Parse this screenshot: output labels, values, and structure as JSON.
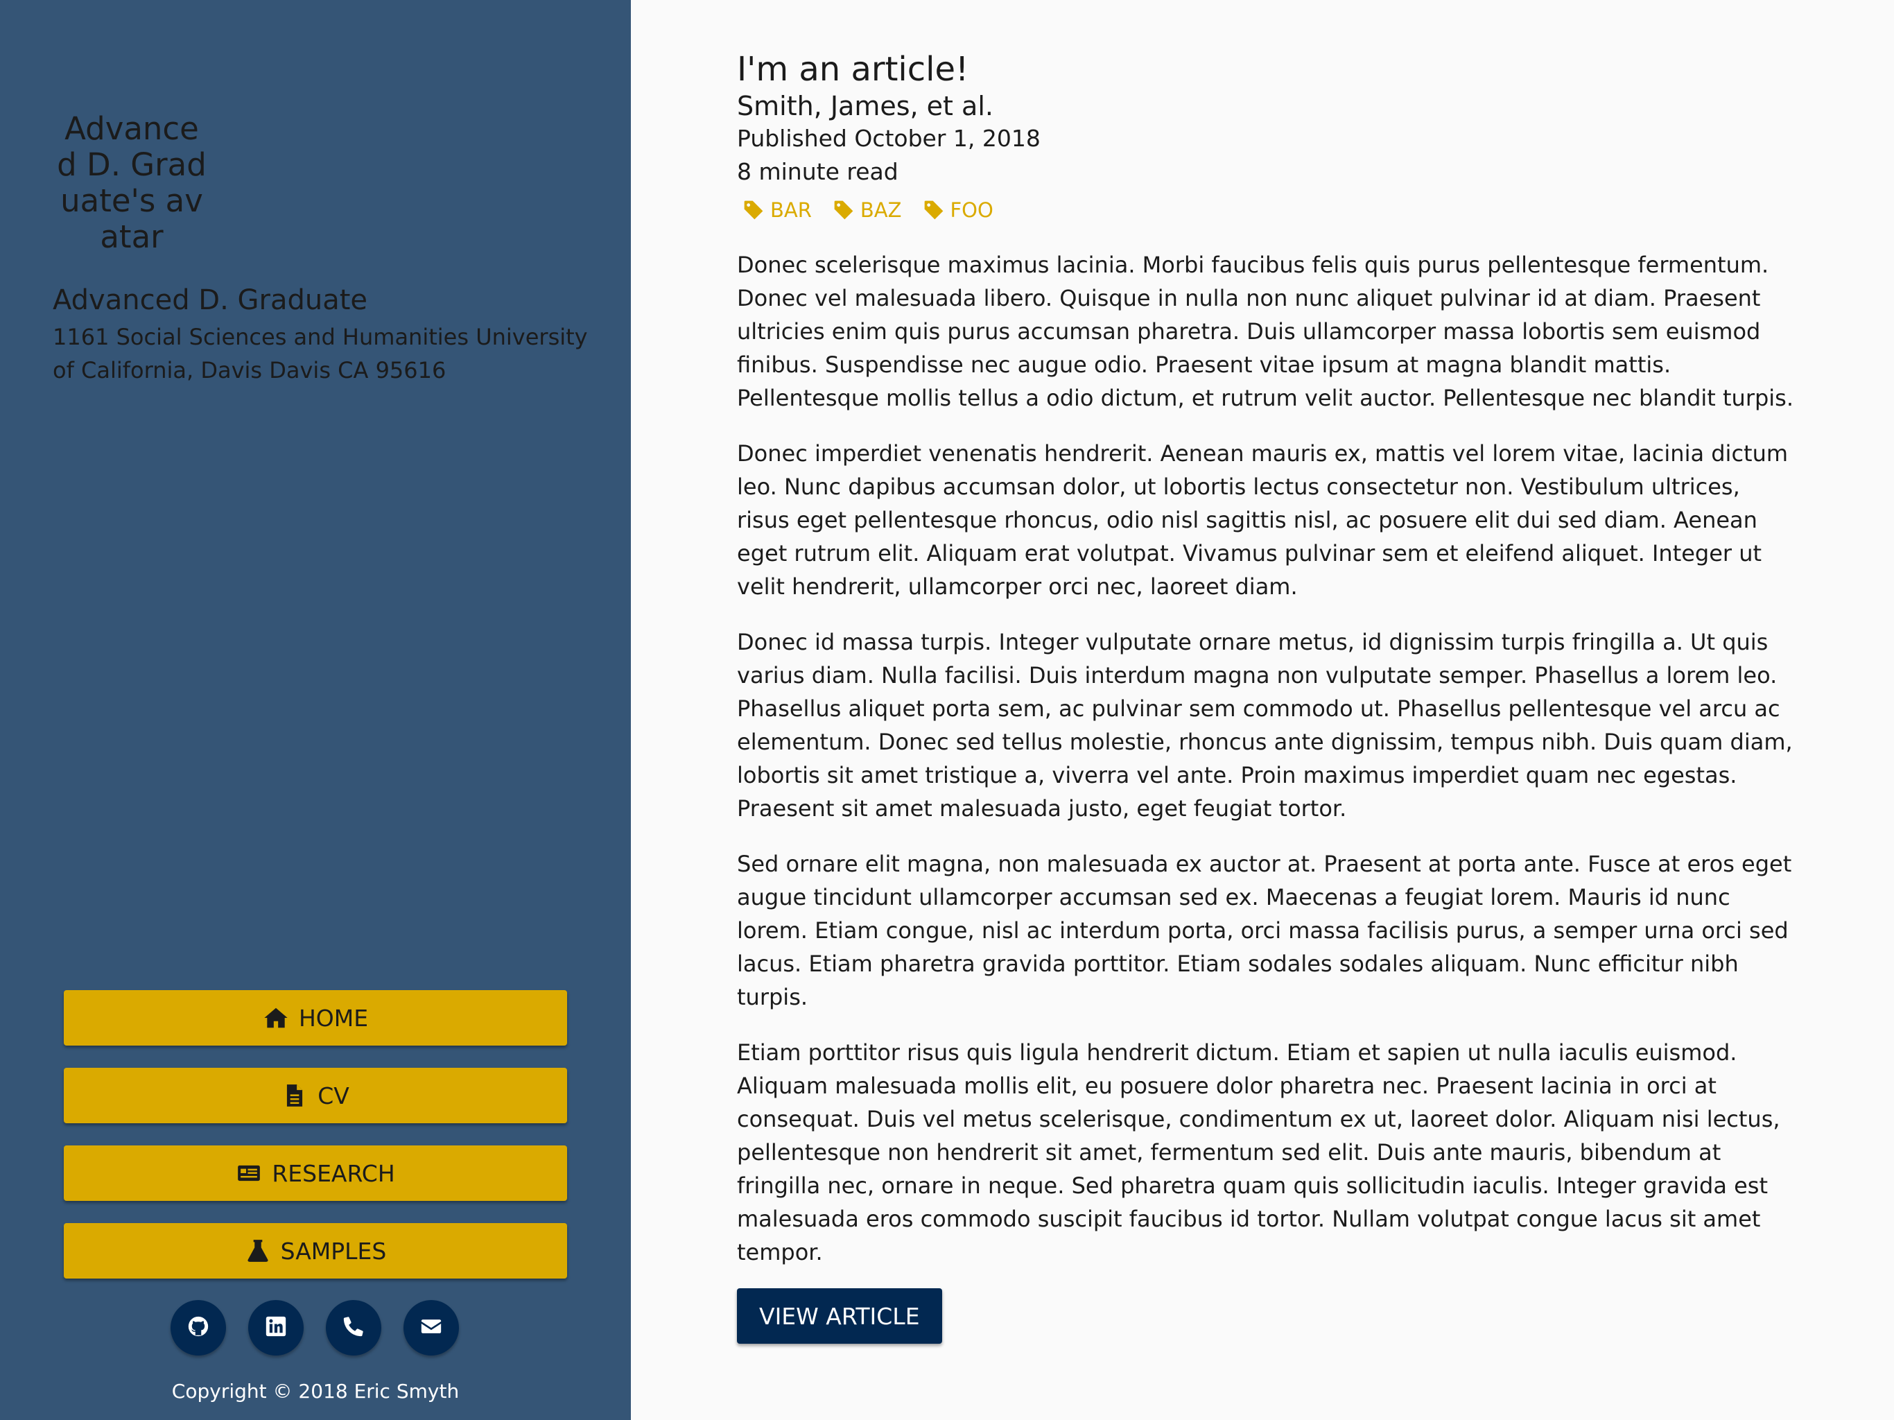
{
  "sidebar": {
    "avatar_alt": "Advanced D. Graduate's avatar",
    "name": "Advanced D. Graduate",
    "address": "1161 Social Sciences and Humanities University of California, Davis Davis CA 95616",
    "nav": [
      {
        "label": "HOME",
        "icon": "home-icon"
      },
      {
        "label": "CV",
        "icon": "file-icon"
      },
      {
        "label": "RESEARCH",
        "icon": "newspaper-icon"
      },
      {
        "label": "SAMPLES",
        "icon": "flask-icon"
      }
    ],
    "social": [
      {
        "icon": "github-icon"
      },
      {
        "icon": "linkedin-icon"
      },
      {
        "icon": "phone-icon"
      },
      {
        "icon": "envelope-icon"
      }
    ],
    "copyright": "Copyright © 2018 Eric Smyth"
  },
  "article": {
    "title": "I'm an article!",
    "authors": "Smith, James, et al.",
    "published": "Published October 1, 2018",
    "read_time": "8 minute read",
    "tags": [
      "BAR",
      "BAZ",
      "FOO"
    ],
    "paragraphs": [
      "Donec scelerisque maximus lacinia. Morbi faucibus felis quis purus pellentesque fermentum. Donec vel malesuada libero. Quisque in nulla non nunc aliquet pulvinar id at diam. Praesent ultricies enim quis purus accumsan pharetra. Duis ullamcorper massa lobortis sem euismod finibus. Suspendisse nec augue odio. Praesent vitae ipsum at magna blandit mattis. Pellentesque mollis tellus a odio dictum, et rutrum velit auctor. Pellentesque nec blandit turpis.",
      "Donec imperdiet venenatis hendrerit. Aenean mauris ex, mattis vel lorem vitae, lacinia dictum leo. Nunc dapibus accumsan dolor, ut lobortis lectus consectetur non. Vestibulum ultrices, risus eget pellentesque rhoncus, odio nisl sagittis nisl, ac posuere elit dui sed diam. Aenean eget rutrum elit. Aliquam erat volutpat. Vivamus pulvinar sem et eleifend aliquet. Integer ut velit hendrerit, ullamcorper orci nec, laoreet diam.",
      "Donec id massa turpis. Integer vulputate ornare metus, id dignissim turpis fringilla a. Ut quis varius diam. Nulla facilisi. Duis interdum magna non vulputate semper. Phasellus a lorem leo. Phasellus aliquet porta sem, ac pulvinar sem commodo ut. Phasellus pellentesque vel arcu ac elementum. Donec sed tellus molestie, rhoncus ante dignissim, tempus nibh. Duis quam diam, lobortis sit amet tristique a, viverra vel ante. Proin maximus imperdiet quam nec egestas. Praesent sit amet malesuada justo, eget feugiat tortor.",
      "Sed ornare elit magna, non malesuada ex auctor at. Praesent at porta ante. Fusce at eros eget augue tincidunt ullamcorper accumsan sed ex. Maecenas a feugiat lorem. Mauris id nunc lorem. Etiam congue, nisl ac interdum porta, orci massa facilisis purus, a semper urna orci sed lacus. Etiam pharetra gravida porttitor. Etiam sodales sodales aliquam. Nunc efficitur nibh turpis.",
      "Etiam porttitor risus quis ligula hendrerit dictum. Etiam et sapien ut nulla iaculis euismod. Aliquam malesuada mollis elit, eu posuere dolor pharetra nec. Praesent lacinia in orci at consequat. Duis vel metus scelerisque, condimentum ex ut, laoreet dolor. Aliquam nisi lectus, pellentesque non hendrerit sit amet, fermentum sed elit. Duis ante mauris, bibendum at fringilla nec, ornare in neque. Sed pharetra quam quis sollicitudin iaculis. Integer gravida est malesuada eros commodo suscipit faucibus id tortor. Nullam volutpat congue lacus sit amet tempor."
    ],
    "view_button": "VIEW ARTICLE"
  },
  "colors": {
    "sidebar_bg": "#355576",
    "gold": "#daaa00",
    "navy": "#022851",
    "page_bg": "#fafafa"
  }
}
